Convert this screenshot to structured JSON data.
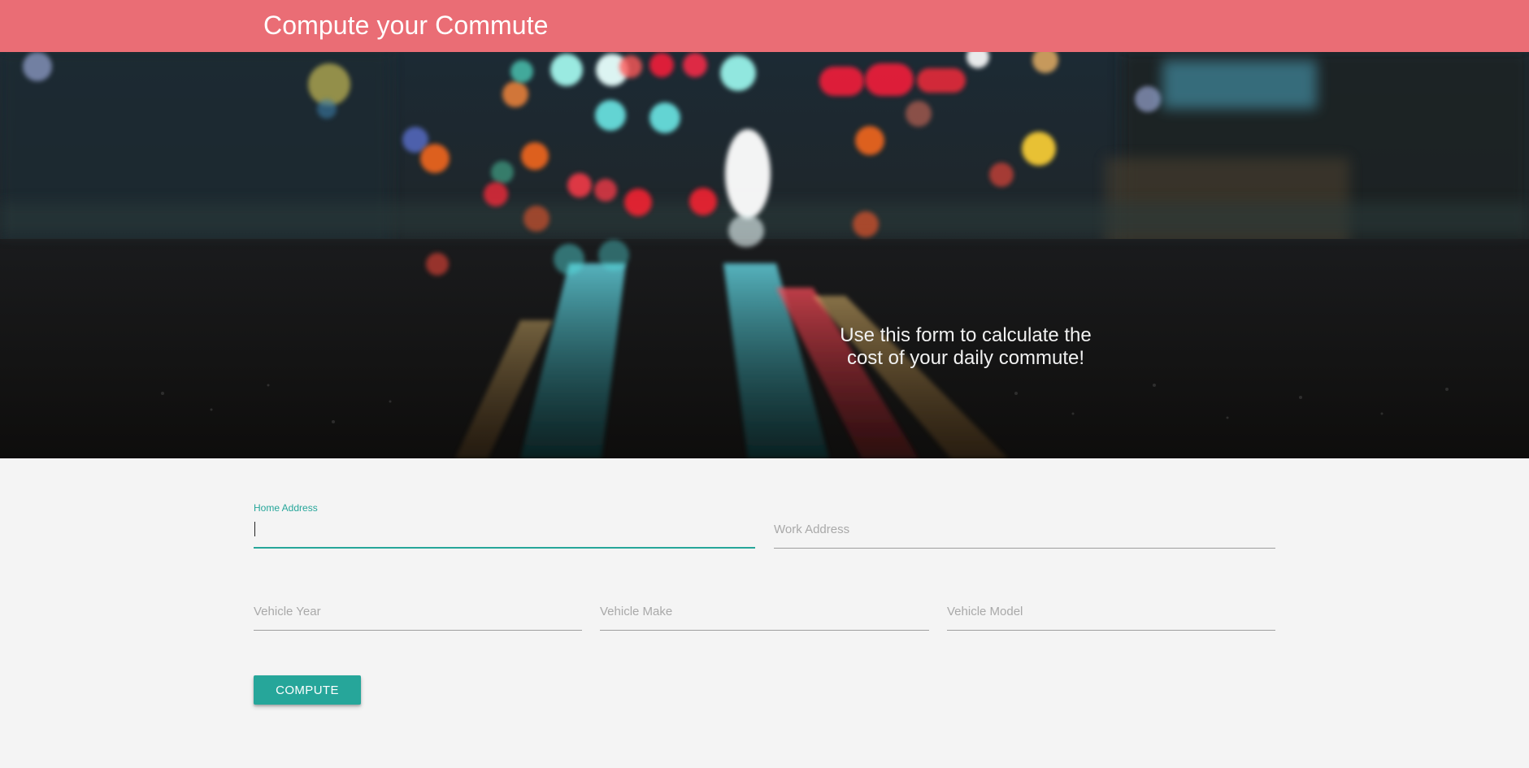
{
  "app": {
    "title": "Compute your Commute"
  },
  "hero": {
    "line1": "Use this form to calculate the",
    "line2": "cost of your daily commute!",
    "image": "night-street-bokeh"
  },
  "form": {
    "home_address": {
      "label": "Home Address",
      "value": "",
      "focused": true
    },
    "work_address": {
      "label": "Work Address",
      "value": ""
    },
    "vehicle_year": {
      "label": "Vehicle Year",
      "value": ""
    },
    "vehicle_make": {
      "label": "Vehicle Make",
      "value": ""
    },
    "vehicle_model": {
      "label": "Vehicle Model",
      "value": ""
    },
    "compute_label": "COMPUTE"
  },
  "colors": {
    "header": "#ea6d75",
    "accent": "#26a69a",
    "background": "#f4f4f4",
    "input_line": "#9e9e9e",
    "placeholder": "#a9a9a9"
  }
}
